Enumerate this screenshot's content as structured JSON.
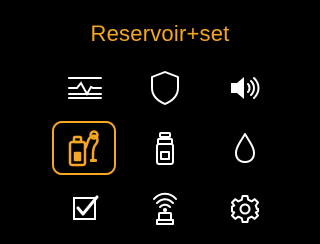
{
  "screen": {
    "title": "Reservoir+set"
  },
  "colors": {
    "accent": "#f5a623",
    "icon": "#ffffff",
    "background": "#000000"
  },
  "menu": {
    "selected": "reservoir-set",
    "items": [
      {
        "id": "history",
        "icon": "graph-line-icon"
      },
      {
        "id": "security",
        "icon": "shield-icon"
      },
      {
        "id": "sound",
        "icon": "speaker-icon"
      },
      {
        "id": "reservoir-set",
        "icon": "reservoir-set-icon"
      },
      {
        "id": "reservoir",
        "icon": "reservoir-icon"
      },
      {
        "id": "prime",
        "icon": "drop-icon"
      },
      {
        "id": "checks",
        "icon": "checkbox-icon"
      },
      {
        "id": "connection",
        "icon": "wireless-icon"
      },
      {
        "id": "settings",
        "icon": "gear-icon"
      }
    ]
  }
}
